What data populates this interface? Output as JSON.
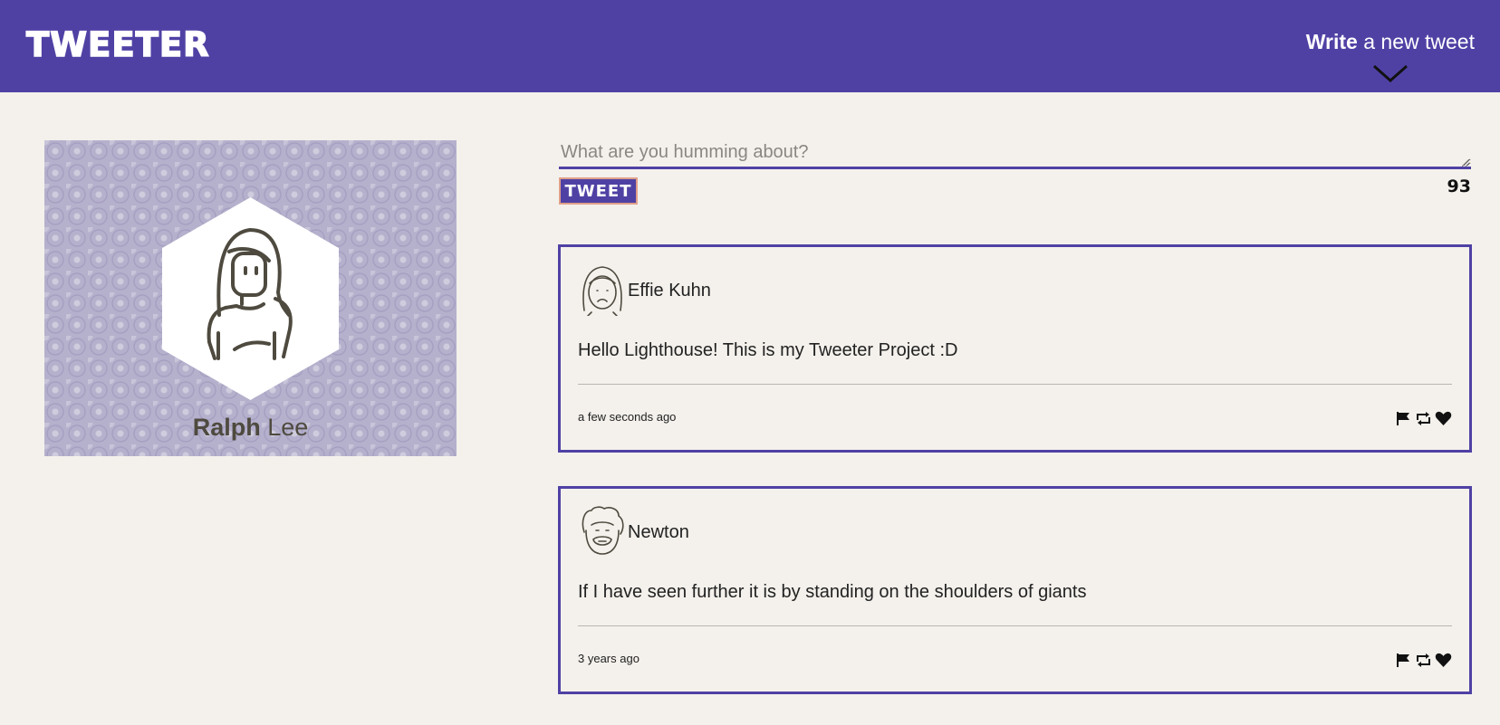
{
  "nav": {
    "brand": "TWEETER",
    "write_bold": "Write",
    "write_rest": " a new tweet",
    "accent_color": "#4f41a4"
  },
  "profile": {
    "first_name": "Ralph",
    "last_name": " Lee",
    "avatar_icon": "user-avatar-icon"
  },
  "composer": {
    "placeholder": "What are you humming about?",
    "value": "",
    "button_label": "TWEET",
    "counter": "93"
  },
  "tweets": [
    {
      "author": "Effie Kuhn",
      "content": "Hello Lighthouse! This is my Tweeter Project :D",
      "timestamp": "a few seconds ago",
      "avatar_icon": "girl-avatar-icon"
    },
    {
      "author": "Newton",
      "content": "If I have seen further it is by standing on the shoulders of giants",
      "timestamp": "3 years ago",
      "avatar_icon": "man-avatar-icon"
    }
  ],
  "action_icons": [
    "flag-icon",
    "retweet-icon",
    "heart-icon"
  ]
}
